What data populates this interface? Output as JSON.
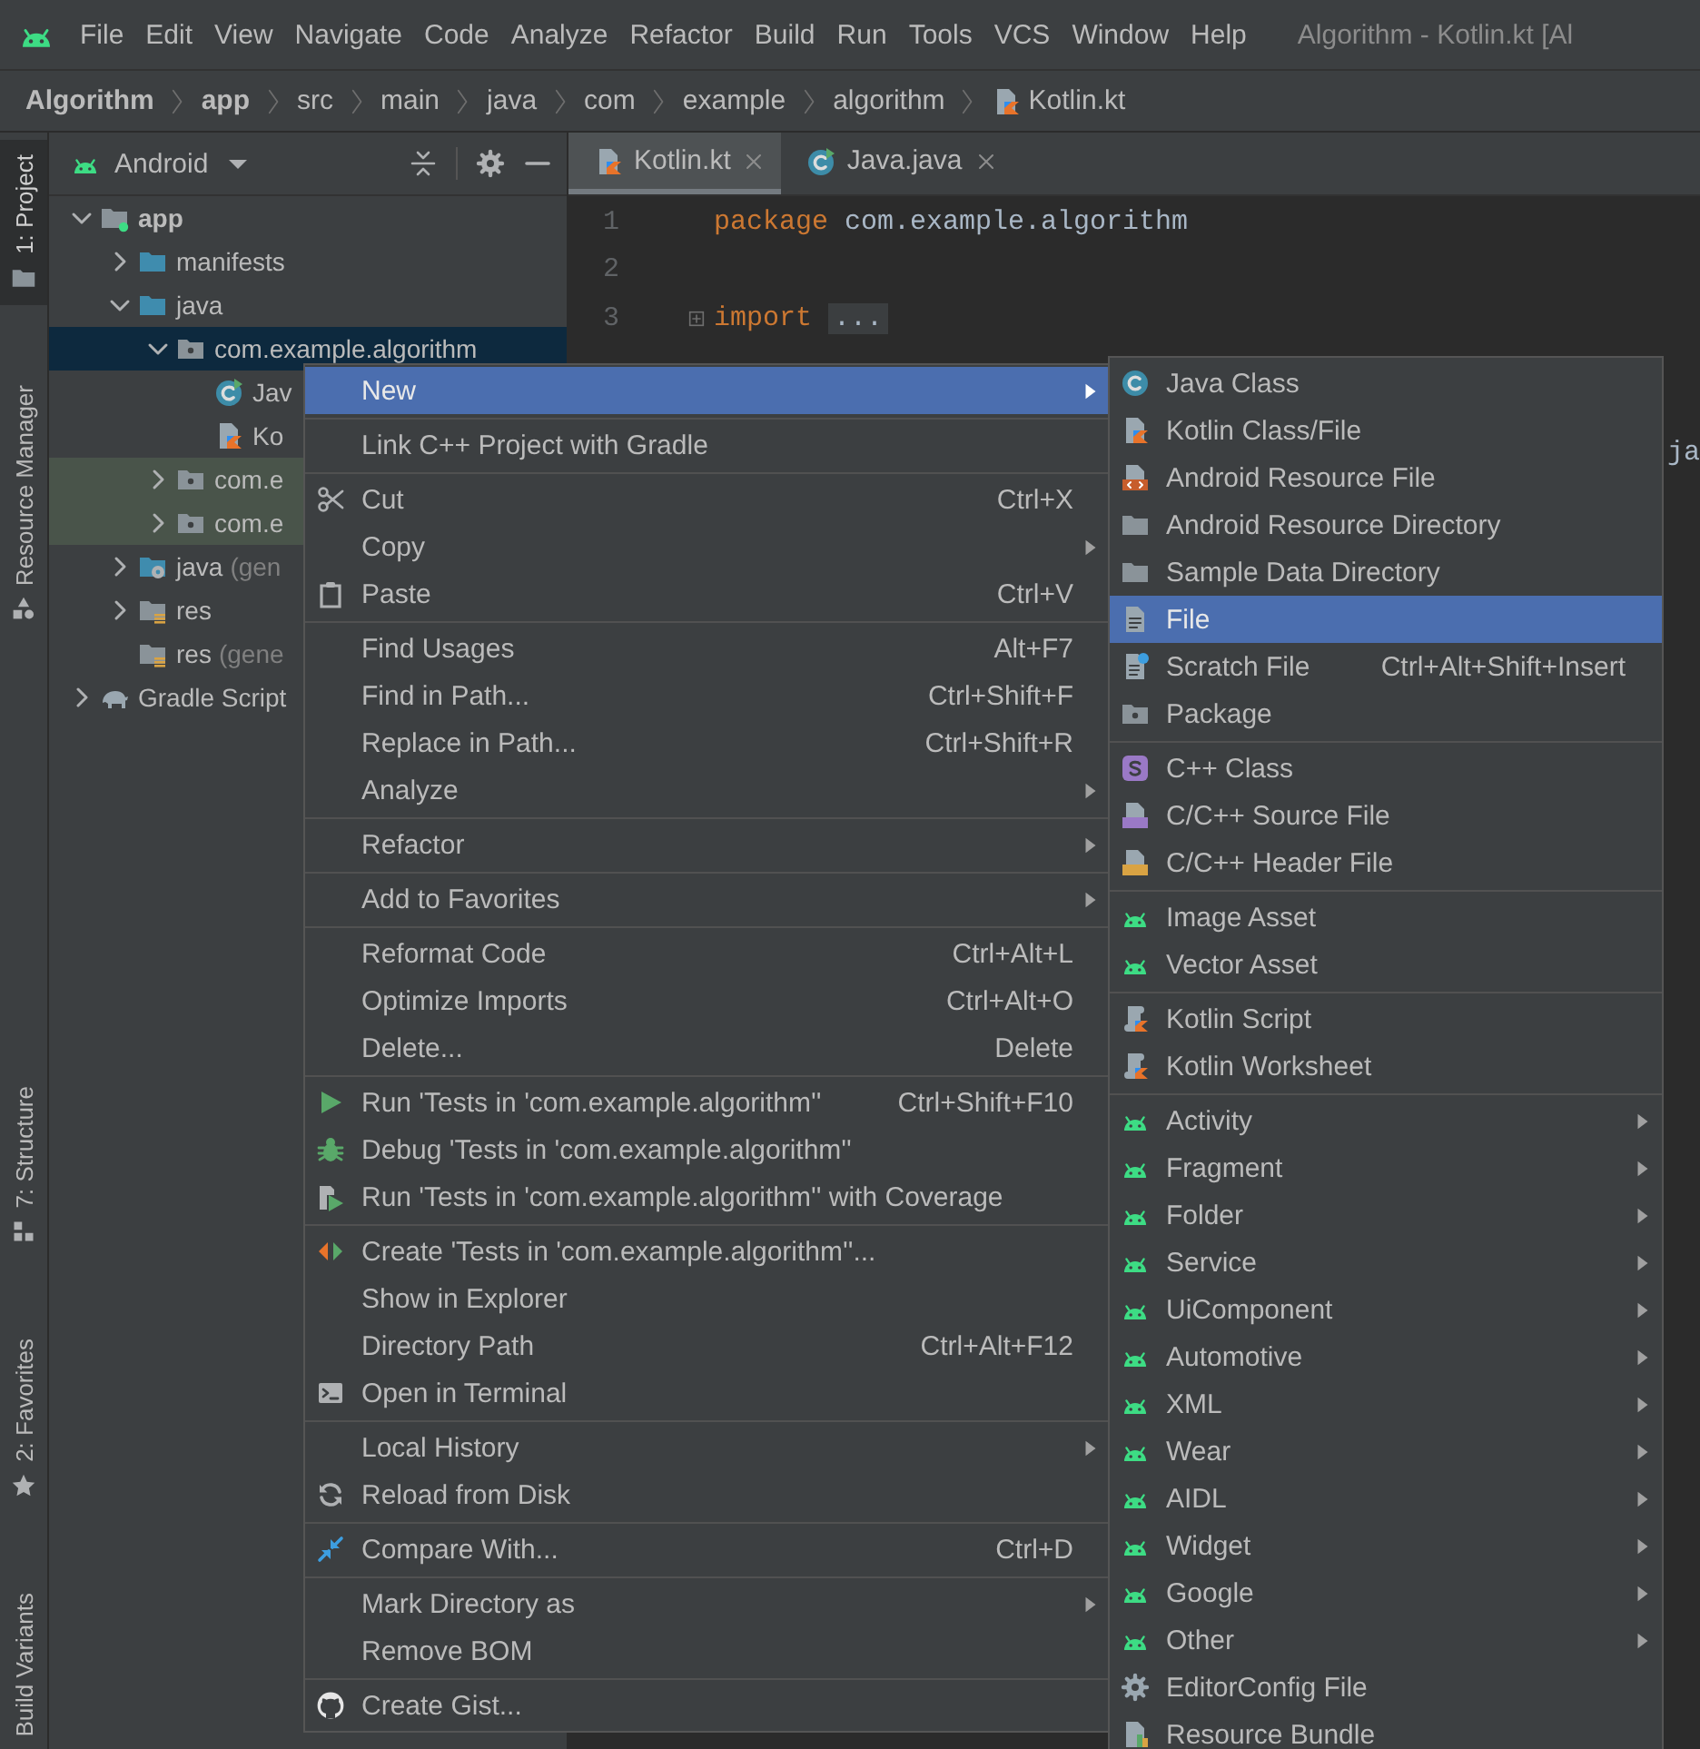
{
  "menu_bar": {
    "items": [
      "File",
      "Edit",
      "View",
      "Navigate",
      "Code",
      "Analyze",
      "Refactor",
      "Build",
      "Run",
      "Tools",
      "VCS",
      "Window",
      "Help"
    ],
    "title": "Algorithm - Kotlin.kt [Al"
  },
  "breadcrumb": [
    {
      "label": "Algorithm",
      "bold": true,
      "kind": "folder"
    },
    {
      "label": "app",
      "bold": true,
      "kind": "folder"
    },
    {
      "label": "src",
      "bold": false,
      "kind": "folder"
    },
    {
      "label": "main",
      "bold": false,
      "kind": "folder"
    },
    {
      "label": "java",
      "bold": false,
      "kind": "folder"
    },
    {
      "label": "com",
      "bold": false,
      "kind": "folder"
    },
    {
      "label": "example",
      "bold": false,
      "kind": "folder"
    },
    {
      "label": "algorithm",
      "bold": false,
      "kind": "folder"
    },
    {
      "label": "Kotlin.kt",
      "bold": false,
      "kind": "file"
    }
  ],
  "tool_strip": {
    "top": [
      {
        "label": "1: Project",
        "kind": "project",
        "selected": true
      },
      {
        "label": "Resource Manager",
        "kind": "resources",
        "selected": false
      }
    ],
    "bottom": [
      {
        "label": "7: Structure",
        "kind": "structure",
        "selected": false
      },
      {
        "label": "2: Favorites",
        "kind": "favorites",
        "selected": false
      },
      {
        "label": "Build Variants",
        "kind": "variants",
        "selected": false
      }
    ]
  },
  "project_panel": {
    "view": "Android",
    "tree": [
      {
        "label": "app",
        "kind": "module",
        "bold": true,
        "expanded": true,
        "selected": false,
        "highlighted": false,
        "children": [
          {
            "label": "manifests",
            "kind": "source-folder",
            "expanded": false,
            "selected": false,
            "highlighted": false
          },
          {
            "label": "java",
            "kind": "source-folder",
            "expanded": true,
            "selected": false,
            "highlighted": false,
            "children": [
              {
                "label": "com.example.algorithm",
                "kind": "package",
                "expanded": true,
                "selected": true,
                "highlighted": false,
                "children": [
                  {
                    "label": "Jav",
                    "kind": "class",
                    "selected": false,
                    "highlighted": false
                  },
                  {
                    "label": "Ko",
                    "kind": "kotlin-file",
                    "selected": false,
                    "highlighted": false
                  }
                ]
              },
              {
                "label": "com.e",
                "kind": "package",
                "expanded": false,
                "selected": false,
                "highlighted": true
              },
              {
                "label": "com.e",
                "kind": "package",
                "expanded": false,
                "selected": false,
                "highlighted": true
              }
            ]
          },
          {
            "label": "java",
            "note": "(gen",
            "kind": "generated-folder",
            "expanded": false,
            "selected": false,
            "highlighted": false
          },
          {
            "label": "res",
            "kind": "resource-folder",
            "expanded": false,
            "selected": false,
            "highlighted": false
          },
          {
            "label": "res",
            "note": "(gene",
            "kind": "resource-folder",
            "selected": false,
            "highlighted": false
          }
        ]
      },
      {
        "label": "Gradle Script",
        "kind": "gradle",
        "expanded": false,
        "selected": false,
        "highlighted": false
      }
    ]
  },
  "editor": {
    "tabs": [
      {
        "label": "Kotlin.kt",
        "kind": "kotlin",
        "selected": true
      },
      {
        "label": "Java.java",
        "kind": "java",
        "selected": false
      }
    ],
    "lines": [
      {
        "number": "1",
        "tokens": [
          {
            "text": "package",
            "kind": "keyword"
          },
          {
            "text": "com.example.algorithm",
            "kind": "plain"
          }
        ]
      },
      {
        "number": "2"
      },
      {
        "number": "3",
        "tokens": [
          {
            "text": "import",
            "kind": "keyword"
          },
          {
            "text": "...",
            "kind": "fold"
          }
        ]
      }
    ],
    "hidden_fragment": "ja"
  },
  "context_menu": {
    "groups": [
      [
        {
          "label": "New",
          "kind": "plain",
          "submenu": true,
          "selected": true
        }
      ],
      [
        {
          "label": "Link C++ Project with Gradle",
          "kind": "plain",
          "submenu": false,
          "selected": false
        }
      ],
      [
        {
          "label": "Cut",
          "kind": "scissors",
          "shortcut": "Ctrl+X",
          "submenu": false,
          "selected": false
        },
        {
          "label": "Copy",
          "kind": "plain",
          "submenu": true,
          "selected": false
        },
        {
          "label": "Paste",
          "kind": "clipboard",
          "shortcut": "Ctrl+V",
          "submenu": false,
          "selected": false
        }
      ],
      [
        {
          "label": "Find Usages",
          "kind": "plain",
          "shortcut": "Alt+F7",
          "submenu": false,
          "selected": false
        },
        {
          "label": "Find in Path...",
          "kind": "plain",
          "shortcut": "Ctrl+Shift+F",
          "submenu": false,
          "selected": false
        },
        {
          "label": "Replace in Path...",
          "kind": "plain",
          "shortcut": "Ctrl+Shift+R",
          "submenu": false,
          "selected": false
        },
        {
          "label": "Analyze",
          "kind": "plain",
          "submenu": true,
          "selected": false
        }
      ],
      [
        {
          "label": "Refactor",
          "kind": "plain",
          "submenu": true,
          "selected": false
        }
      ],
      [
        {
          "label": "Add to Favorites",
          "kind": "plain",
          "submenu": true,
          "selected": false
        }
      ],
      [
        {
          "label": "Reformat Code",
          "kind": "plain",
          "shortcut": "Ctrl+Alt+L",
          "submenu": false,
          "selected": false
        },
        {
          "label": "Optimize Imports",
          "kind": "plain",
          "shortcut": "Ctrl+Alt+O",
          "submenu": false,
          "selected": false
        },
        {
          "label": "Delete...",
          "kind": "plain",
          "shortcut": "Delete",
          "submenu": false,
          "selected": false
        }
      ],
      [
        {
          "label": "Run 'Tests in 'com.example.algorithm''",
          "kind": "run",
          "shortcut": "Ctrl+Shift+F10",
          "submenu": false,
          "selected": false
        },
        {
          "label": "Debug 'Tests in 'com.example.algorithm''",
          "kind": "bug",
          "submenu": false,
          "selected": false
        },
        {
          "label": "Run 'Tests in 'com.example.algorithm'' with Coverage",
          "kind": "coverage",
          "submenu": false,
          "selected": false
        }
      ],
      [
        {
          "label": "Create 'Tests in 'com.example.algorithm''...",
          "kind": "create-test",
          "submenu": false,
          "selected": false
        },
        {
          "label": "Show in Explorer",
          "kind": "plain",
          "submenu": false,
          "selected": false
        },
        {
          "label": "Directory Path",
          "kind": "plain",
          "shortcut": "Ctrl+Alt+F12",
          "submenu": false,
          "selected": false
        },
        {
          "label": "Open in Terminal",
          "kind": "terminal",
          "submenu": false,
          "selected": false
        }
      ],
      [
        {
          "label": "Local History",
          "kind": "plain",
          "submenu": true,
          "selected": false
        },
        {
          "label": "Reload from Disk",
          "kind": "reload",
          "submenu": false,
          "selected": false
        }
      ],
      [
        {
          "label": "Compare With...",
          "kind": "compare",
          "shortcut": "Ctrl+D",
          "submenu": false,
          "selected": false
        }
      ],
      [
        {
          "label": "Mark Directory as",
          "kind": "plain",
          "submenu": true,
          "selected": false
        },
        {
          "label": "Remove BOM",
          "kind": "plain",
          "submenu": false,
          "selected": false
        }
      ],
      [
        {
          "label": "Create Gist...",
          "kind": "gist",
          "submenu": false,
          "selected": false
        }
      ]
    ]
  },
  "submenu": {
    "groups": [
      [
        {
          "label": "Java Class",
          "kind": "java-class",
          "submenu": false,
          "selected": false
        },
        {
          "label": "Kotlin Class/File",
          "kind": "kotlin-file",
          "submenu": false,
          "selected": false
        },
        {
          "label": "Android Resource File",
          "kind": "resource-file",
          "submenu": false,
          "selected": false
        },
        {
          "label": "Android Resource Directory",
          "kind": "directory",
          "submenu": false,
          "selected": false
        },
        {
          "label": "Sample Data Directory",
          "kind": "directory",
          "submenu": false,
          "selected": false
        },
        {
          "label": "File",
          "kind": "file",
          "submenu": false,
          "selected": true
        },
        {
          "label": "Scratch File",
          "kind": "scratch",
          "shortcut": "Ctrl+Alt+Shift+Insert",
          "submenu": false,
          "selected": false
        },
        {
          "label": "Package",
          "kind": "package",
          "submenu": false,
          "selected": false
        }
      ],
      [
        {
          "label": "C++ Class",
          "kind": "cpp-class",
          "submenu": false,
          "selected": false
        },
        {
          "label": "C/C++ Source File",
          "kind": "cpp-source",
          "submenu": false,
          "selected": false
        },
        {
          "label": "C/C++ Header File",
          "kind": "cpp-header",
          "submenu": false,
          "selected": false
        }
      ],
      [
        {
          "label": "Image Asset",
          "kind": "android",
          "submenu": false,
          "selected": false
        },
        {
          "label": "Vector Asset",
          "kind": "android",
          "submenu": false,
          "selected": false
        }
      ],
      [
        {
          "label": "Kotlin Script",
          "kind": "kotlin-script",
          "submenu": false,
          "selected": false
        },
        {
          "label": "Kotlin Worksheet",
          "kind": "kotlin-script",
          "submenu": false,
          "selected": false
        }
      ],
      [
        {
          "label": "Activity",
          "kind": "android",
          "submenu": true,
          "selected": false
        },
        {
          "label": "Fragment",
          "kind": "android",
          "submenu": true,
          "selected": false
        },
        {
          "label": "Folder",
          "kind": "android",
          "submenu": true,
          "selected": false
        },
        {
          "label": "Service",
          "kind": "android",
          "submenu": true,
          "selected": false
        },
        {
          "label": "UiComponent",
          "kind": "android",
          "submenu": true,
          "selected": false
        },
        {
          "label": "Automotive",
          "kind": "android",
          "submenu": true,
          "selected": false
        },
        {
          "label": "XML",
          "kind": "android",
          "submenu": true,
          "selected": false
        },
        {
          "label": "Wear",
          "kind": "android",
          "submenu": true,
          "selected": false
        },
        {
          "label": "AIDL",
          "kind": "android",
          "submenu": true,
          "selected": false
        },
        {
          "label": "Widget",
          "kind": "android",
          "submenu": true,
          "selected": false
        },
        {
          "label": "Google",
          "kind": "android",
          "submenu": true,
          "selected": false
        },
        {
          "label": "Other",
          "kind": "android",
          "submenu": true,
          "selected": false
        },
        {
          "label": "EditorConfig File",
          "kind": "config",
          "submenu": false,
          "selected": false
        },
        {
          "label": "Resource Bundle",
          "kind": "bundle",
          "submenu": false,
          "selected": false
        }
      ]
    ]
  }
}
